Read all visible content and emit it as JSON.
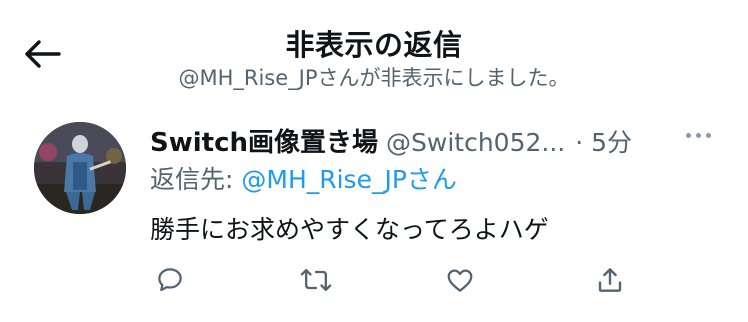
{
  "header": {
    "title": "非表示の返信",
    "subtitle": "@MH_Rise_JPさんが非表示にしました。",
    "back_icon": "arrow-left-icon"
  },
  "tweet": {
    "display_name": "Switch画像置き場",
    "handle": "@Switch052...",
    "time": "· 5分",
    "reply_prefix": "返信先: ",
    "reply_to": "@MH_Rise_JPさん",
    "text": "勝手にお求めやすくなってろよハゲ",
    "more_icon": "more-horizontal-icon",
    "avatar_alt": "avatar"
  },
  "actions": [
    {
      "name": "reply",
      "icon": "reply-icon"
    },
    {
      "name": "retweet",
      "icon": "retweet-icon"
    },
    {
      "name": "like",
      "icon": "heart-icon"
    },
    {
      "name": "share",
      "icon": "share-icon"
    }
  ],
  "colors": {
    "link": "#1d9bf0",
    "secondary_text": "#536471",
    "primary_text": "#0f1419",
    "icon": "#536471"
  }
}
